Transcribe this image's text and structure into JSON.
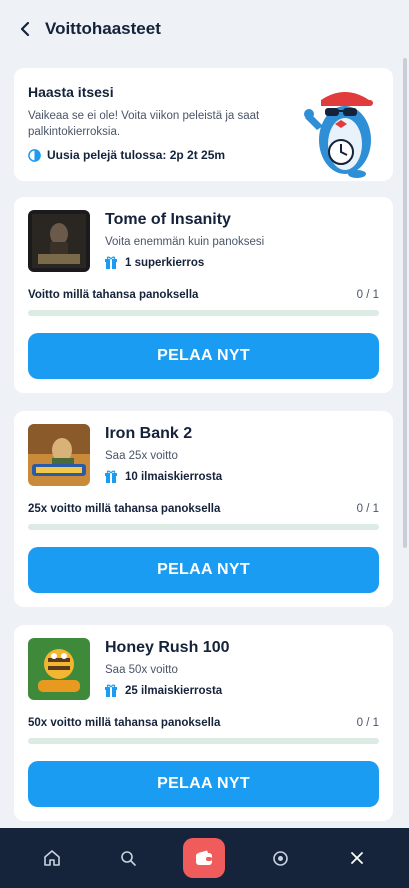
{
  "header": {
    "title": "Voittohaasteet"
  },
  "intro": {
    "title": "Haasta itsesi",
    "text": "Vaikeaa se ei ole! Voita viikon peleistä ja saat palkintokierroksia.",
    "timer": "Uusia pelejä tulossa: 2p 2t 25m"
  },
  "games": [
    {
      "name": "Tome of Insanity",
      "subtitle": "Voita enemmän kuin panoksesi",
      "reward": "1 superkierros",
      "condition": "Voitto millä tahansa panoksella",
      "progress_text": "0 / 1",
      "progress": 0,
      "button": "PELAA NYT"
    },
    {
      "name": "Iron Bank 2",
      "subtitle": "Saa 25x voitto",
      "reward": "10 ilmaiskierrosta",
      "condition": "25x voitto millä tahansa panoksella",
      "progress_text": "0 / 1",
      "progress": 0,
      "button": "PELAA NYT"
    },
    {
      "name": "Honey Rush 100",
      "subtitle": "Saa 50x voitto",
      "reward": "25 ilmaiskierrosta",
      "condition": "50x voitto millä tahansa panoksella",
      "progress_text": "0 / 1",
      "progress": 0,
      "button": "PELAA NYT"
    }
  ],
  "nav": {
    "items": [
      "home-icon",
      "search-icon",
      "wallet-icon",
      "live-icon",
      "close-icon"
    ]
  },
  "colors": {
    "accent": "#1a9cf2",
    "nav_bg": "#15243b",
    "wallet": "#f05b5b",
    "progress_track": "#dcebe3"
  }
}
